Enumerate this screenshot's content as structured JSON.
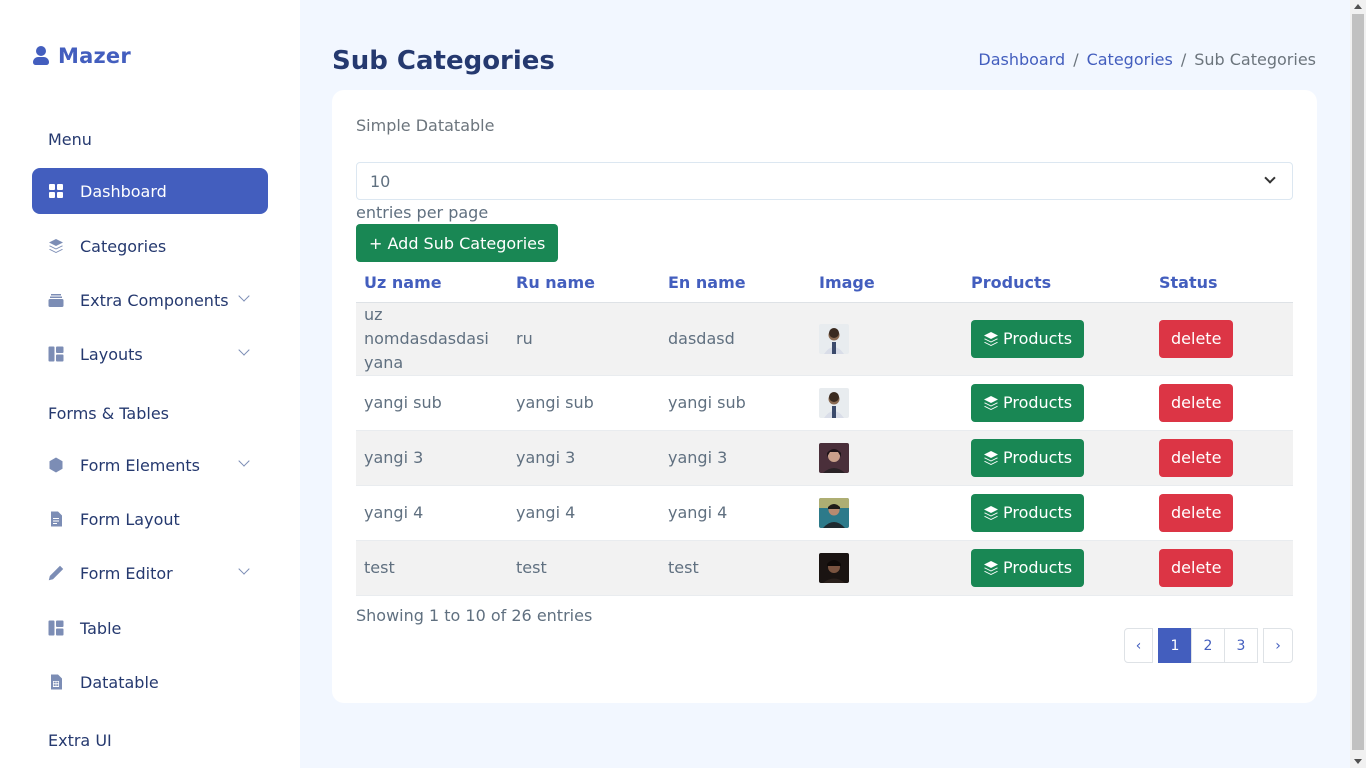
{
  "brand": {
    "name": "Mazer"
  },
  "sidebar": {
    "sections": [
      {
        "title": "Menu"
      },
      {
        "title": "Forms & Tables"
      },
      {
        "title": "Extra UI"
      }
    ],
    "items": [
      {
        "label": "Dashboard",
        "icon": "grid-icon",
        "active": true
      },
      {
        "label": "Categories",
        "icon": "stack-icon"
      },
      {
        "label": "Extra Components",
        "icon": "collection-icon",
        "has_submenu": true
      },
      {
        "label": "Layouts",
        "icon": "layout-icon",
        "has_submenu": true
      },
      {
        "label": "Form Elements",
        "icon": "hexagon-icon",
        "has_submenu": true
      },
      {
        "label": "Form Layout",
        "icon": "file-text-icon"
      },
      {
        "label": "Form Editor",
        "icon": "pen-icon",
        "has_submenu": true
      },
      {
        "label": "Table",
        "icon": "layout-icon"
      },
      {
        "label": "Datatable",
        "icon": "file-spreadsheet-icon"
      }
    ]
  },
  "header": {
    "title": "Sub Categories",
    "breadcrumb": [
      "Dashboard",
      "Categories",
      "Sub Categories"
    ],
    "separator": "/"
  },
  "card": {
    "title": "Simple Datatable",
    "per_page": {
      "value": "10",
      "label": "entries per page"
    },
    "add_button": "+ Add Sub Categories",
    "columns": [
      "Uz name",
      "Ru name",
      "En name",
      "Image",
      "Products",
      "Status"
    ],
    "rows": [
      {
        "uz": "uz nomdasdasdasi yana",
        "ru": "ru",
        "en": "dasdasd",
        "image": "avatar-1",
        "products": "Products",
        "status": "delete"
      },
      {
        "uz": "yangi sub",
        "ru": "yangi sub",
        "en": "yangi sub",
        "image": "avatar-1",
        "products": "Products",
        "status": "delete"
      },
      {
        "uz": "yangi 3",
        "ru": "yangi 3",
        "en": "yangi 3",
        "image": "avatar-2",
        "products": "Products",
        "status": "delete"
      },
      {
        "uz": "yangi 4",
        "ru": "yangi 4",
        "en": "yangi 4",
        "image": "avatar-3",
        "products": "Products",
        "status": "delete"
      },
      {
        "uz": "test",
        "ru": "test",
        "en": "test",
        "image": "avatar-4",
        "products": "Products",
        "status": "delete"
      }
    ],
    "showing": "Showing 1 to 10 of 26 entries",
    "pagination": {
      "prev": "‹",
      "pages": [
        "1",
        "2",
        "3"
      ],
      "current": "1",
      "next": "›"
    }
  },
  "colors": {
    "primary": "#435ebe",
    "success": "#198754",
    "danger": "#dc3545",
    "background": "#f2f7ff",
    "heading": "#25396f"
  }
}
